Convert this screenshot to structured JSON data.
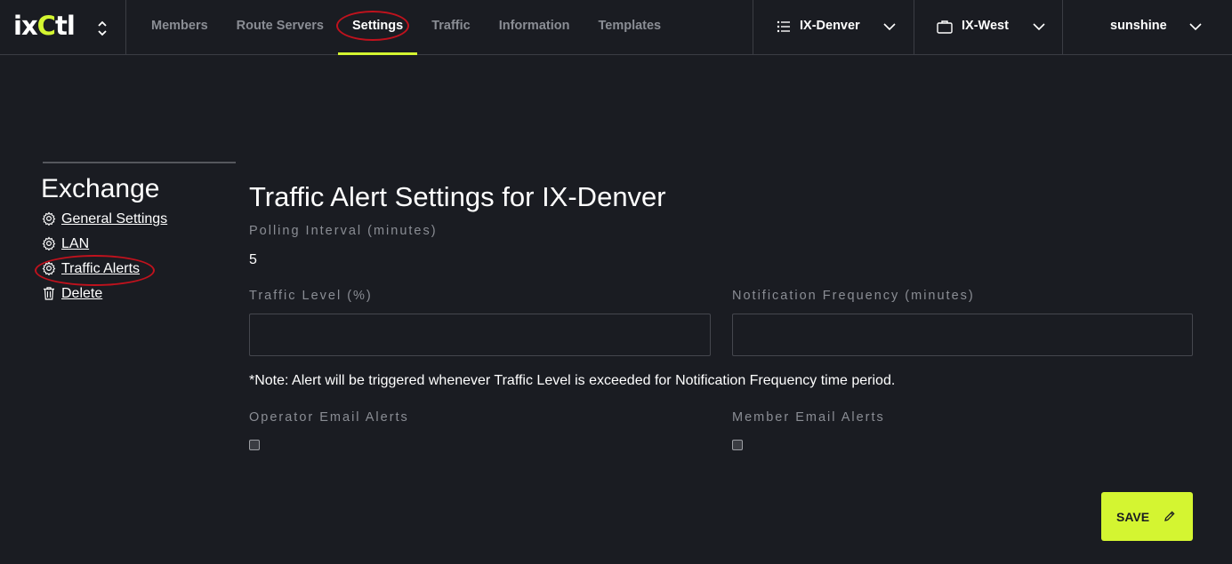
{
  "app": {
    "logo_main": "ix",
    "logo_accent": "C",
    "logo_tail": "tl"
  },
  "nav": {
    "items": [
      {
        "label": "Members"
      },
      {
        "label": "Route Servers"
      },
      {
        "label": "Settings"
      },
      {
        "label": "Traffic"
      },
      {
        "label": "Information"
      },
      {
        "label": "Templates"
      }
    ],
    "active": "Settings"
  },
  "selectors": {
    "exchange": {
      "label": "IX-Denver",
      "icon": "list-icon"
    },
    "organization": {
      "label": "IX-West",
      "icon": "briefcase-icon"
    },
    "user": {
      "label": "sunshine"
    }
  },
  "sidebar": {
    "title": "Exchange",
    "items": [
      {
        "label": "General Settings",
        "icon": "gear-icon"
      },
      {
        "label": "LAN",
        "icon": "gear-icon"
      },
      {
        "label": "Traffic Alerts",
        "icon": "gear-icon"
      },
      {
        "label": "Delete",
        "icon": "trash-icon"
      }
    ]
  },
  "form": {
    "title": "Traffic Alert Settings for IX-Denver",
    "polling_label": "Polling Interval (minutes)",
    "polling_value": "5",
    "traffic_level_label": "Traffic Level (%)",
    "traffic_level_value": "",
    "notification_label": "Notification Frequency (minutes)",
    "notification_value": "",
    "note": "*Note: Alert will be triggered whenever Traffic Level is exceeded for Notification Frequency time period.",
    "operator_email_label": "Operator Email Alerts",
    "operator_email_checked": false,
    "member_email_label": "Member Email Alerts",
    "member_email_checked": false,
    "save_label": "SAVE"
  },
  "colors": {
    "background": "#1a1c22",
    "accent": "#d4f531",
    "annotation": "#c0121d",
    "muted_text": "#8a8d94"
  }
}
